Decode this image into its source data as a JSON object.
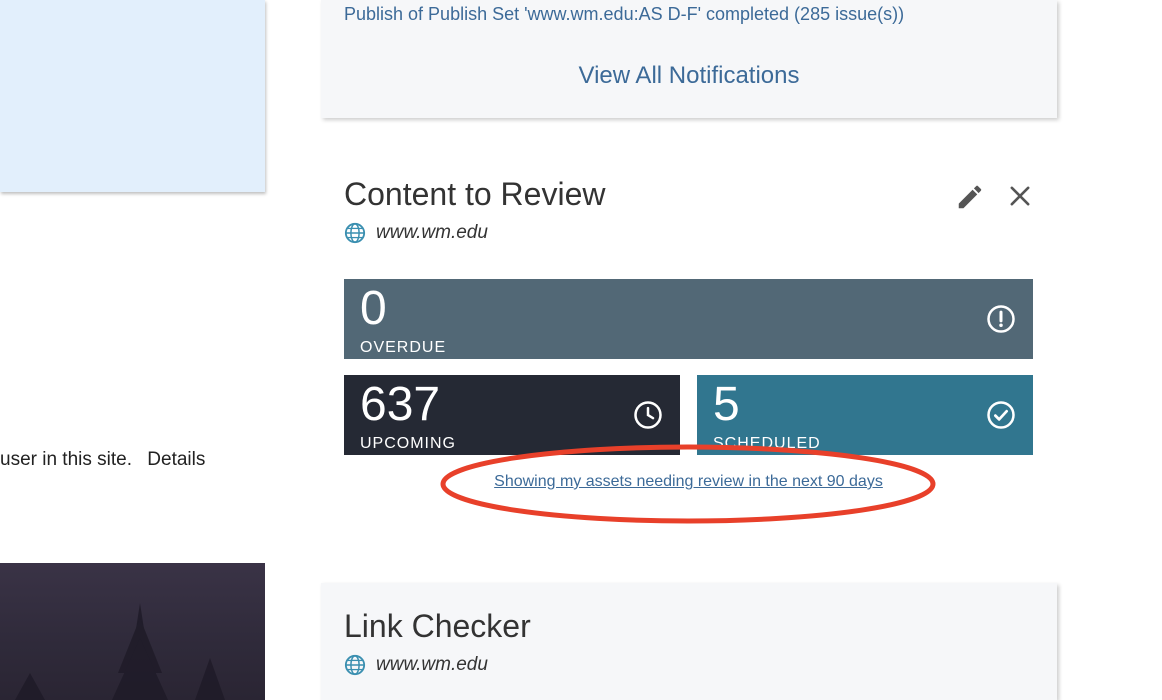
{
  "left": {
    "text_fragment": "user in this site.",
    "details_link": "Details"
  },
  "notifications": {
    "message": "Publish of Publish Set 'www.wm.edu:AS D-F' completed (285 issue(s))",
    "view_all": "View All Notifications"
  },
  "content_review": {
    "title": "Content to Review",
    "site": "www.wm.edu",
    "overdue": {
      "value": "0",
      "label": "OVERDUE"
    },
    "upcoming": {
      "value": "637",
      "label": "UPCOMING"
    },
    "scheduled": {
      "value": "5",
      "label": "SCHEDULED"
    },
    "review_link": "Showing my assets needing review in the next 90 days",
    "icons": [
      "pencil-icon",
      "close-icon",
      "globe-icon",
      "alert-circle-icon",
      "clock-icon",
      "check-circle-icon"
    ]
  },
  "link_checker": {
    "title": "Link Checker",
    "site": "www.wm.edu"
  },
  "colors": {
    "link": "#3c6a98",
    "overdue_bg": "#526876",
    "upcoming_bg": "#252934",
    "scheduled_bg": "#31768f",
    "annotation_red": "#e8402a"
  }
}
